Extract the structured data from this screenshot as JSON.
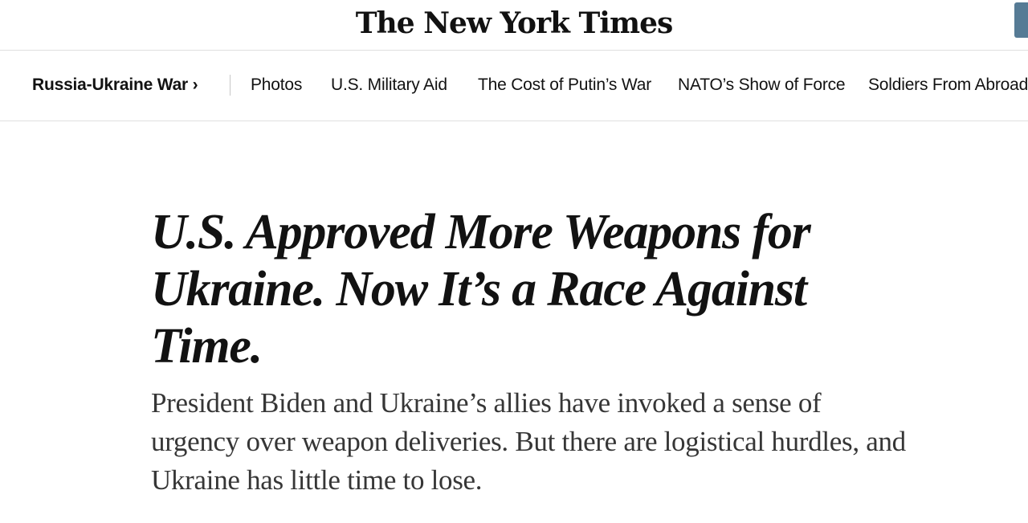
{
  "masthead": {
    "logo_text": "The New York Times"
  },
  "section_nav": {
    "section_label": "Russia-Ukraine War",
    "section_chevron": "›",
    "items": [
      {
        "label": "Photos"
      },
      {
        "label": "U.S. Military Aid"
      },
      {
        "label": "The Cost of Putin’s War"
      },
      {
        "label": "NATO’s Show of Force"
      },
      {
        "label": "Soldiers From Abroad"
      }
    ]
  },
  "article": {
    "headline": "U.S. Approved More Weapons for Ukraine. Now It’s a Race Against Time.",
    "summary": "President Biden and Ukraine’s allies have invoked a sense of urgency over weapon deliveries. But there are logistical hurdles, and Ukraine has little time to lose."
  },
  "colors": {
    "account_button": "#567b95",
    "text": "#121212",
    "summary_text": "#363636",
    "rule": "#dfdfdf"
  }
}
